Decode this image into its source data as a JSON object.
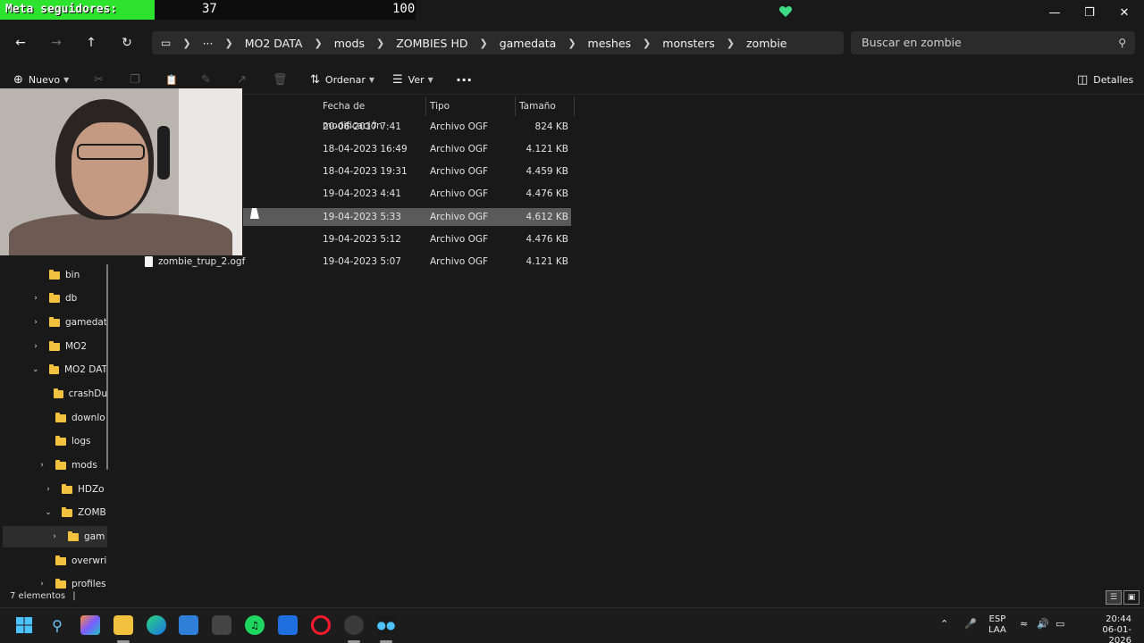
{
  "overlay": {
    "goal_label": "Meta seguidores:",
    "current": "37",
    "goal": "100"
  },
  "window": {
    "controls": [
      "minimize",
      "maximize",
      "close"
    ]
  },
  "nav": {
    "back": "back-arrow",
    "forward": "forward-arrow",
    "up": "up-arrow",
    "refresh": "refresh",
    "breadcrumb_more": "···",
    "breadcrumb": [
      "MO2 DATA",
      "mods",
      "ZOMBIES HD",
      "gamedata",
      "meshes",
      "monsters",
      "zombie"
    ],
    "search_placeholder": "Buscar en zombie"
  },
  "commands": {
    "new_label": "Nuevo",
    "sort_label": "Ordenar",
    "view_label": "Ver",
    "more_label": "···",
    "details_label": "Detalles"
  },
  "columns": {
    "date": "Fecha de modificación",
    "type": "Tipo",
    "size": "Tamaño"
  },
  "files": [
    {
      "name": "",
      "date": "20-06-2017 7:41",
      "type": "Archivo OGF",
      "size": "824 KB",
      "selected": false
    },
    {
      "name": "",
      "date": "18-04-2023 16:49",
      "type": "Archivo OGF",
      "size": "4.121 KB",
      "selected": false
    },
    {
      "name": "",
      "date": "18-04-2023 19:31",
      "type": "Archivo OGF",
      "size": "4.459 KB",
      "selected": false
    },
    {
      "name": "",
      "date": "19-04-2023 4:41",
      "type": "Archivo OGF",
      "size": "4.476 KB",
      "selected": false
    },
    {
      "name": "",
      "date": "19-04-2023 5:33",
      "type": "Archivo OGF",
      "size": "4.612 KB",
      "selected": true
    },
    {
      "name": "",
      "date": "19-04-2023 5:12",
      "type": "Archivo OGF",
      "size": "4.476 KB",
      "selected": false
    },
    {
      "name": "zombie_trup_2.ogf",
      "date": "19-04-2023 5:07",
      "type": "Archivo OGF",
      "size": "4.121 KB",
      "selected": false
    }
  ],
  "tree": [
    {
      "label": "bin",
      "expand": ""
    },
    {
      "label": "db",
      "expand": "›"
    },
    {
      "label": "gamedat",
      "expand": "›"
    },
    {
      "label": "MO2",
      "expand": "›"
    },
    {
      "label": "MO2 DAT",
      "expand": "⌄"
    },
    {
      "label": "crashDu",
      "expand": ""
    },
    {
      "label": "downlo",
      "expand": ""
    },
    {
      "label": "logs",
      "expand": ""
    },
    {
      "label": "mods",
      "expand": "›"
    },
    {
      "label": "HDZo",
      "expand": "›"
    },
    {
      "label": "ZOMB",
      "expand": "⌄"
    },
    {
      "label": "gam",
      "expand": "›"
    },
    {
      "label": "overwri",
      "expand": ""
    },
    {
      "label": "profiles",
      "expand": "›"
    }
  ],
  "status": {
    "count": "7 elementos"
  },
  "taskbar": {
    "lang_top": "ESP",
    "lang_bottom": "LAA",
    "time": "20:44",
    "date": "06-01-2026"
  },
  "colors": {
    "goal_green": "#2ee32e",
    "heart": "#3ddc84",
    "folder": "#f2c23e",
    "selection": "#5a5a5a"
  }
}
